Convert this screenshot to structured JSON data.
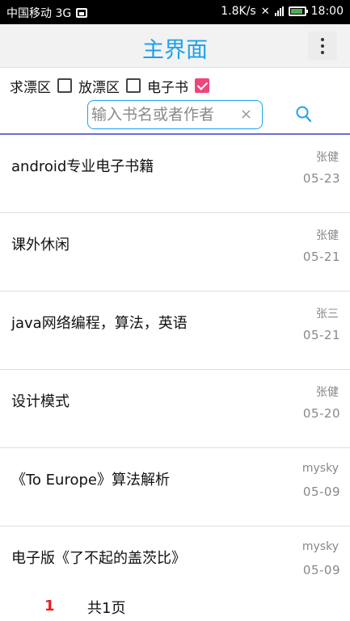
{
  "status_bar": {
    "carrier": "中国移动 3G",
    "speed": "1.8K/s",
    "time": "18:00"
  },
  "header": {
    "title": "主界面"
  },
  "filters": [
    {
      "label": "求漂区",
      "checked": false
    },
    {
      "label": "放漂区",
      "checked": false
    },
    {
      "label": "电子书",
      "checked": true
    }
  ],
  "search": {
    "placeholder": "输入书名或者作者",
    "clear": "×"
  },
  "books": [
    {
      "title": "android专业电子书籍",
      "author": "张健",
      "date": "05-23"
    },
    {
      "title": "课外休闲",
      "author": "张健",
      "date": "05-21"
    },
    {
      "title": "java网络编程，算法，英语",
      "author": "张三",
      "date": "05-21"
    },
    {
      "title": "设计模式",
      "author": "张健",
      "date": "05-20"
    },
    {
      "title": "《To Europe》算法解析",
      "author": "mysky",
      "date": "05-09"
    },
    {
      "title": "电子版《了不起的盖茨比》",
      "author": "mysky",
      "date": "05-09"
    }
  ],
  "pagination": {
    "current": "1",
    "total": "共1页"
  },
  "colors": {
    "accent": "#1ea1ea",
    "checkbox_checked": "#f0447a",
    "current_page": "#ee1c1c",
    "search_underline": "#6b6fd6"
  }
}
